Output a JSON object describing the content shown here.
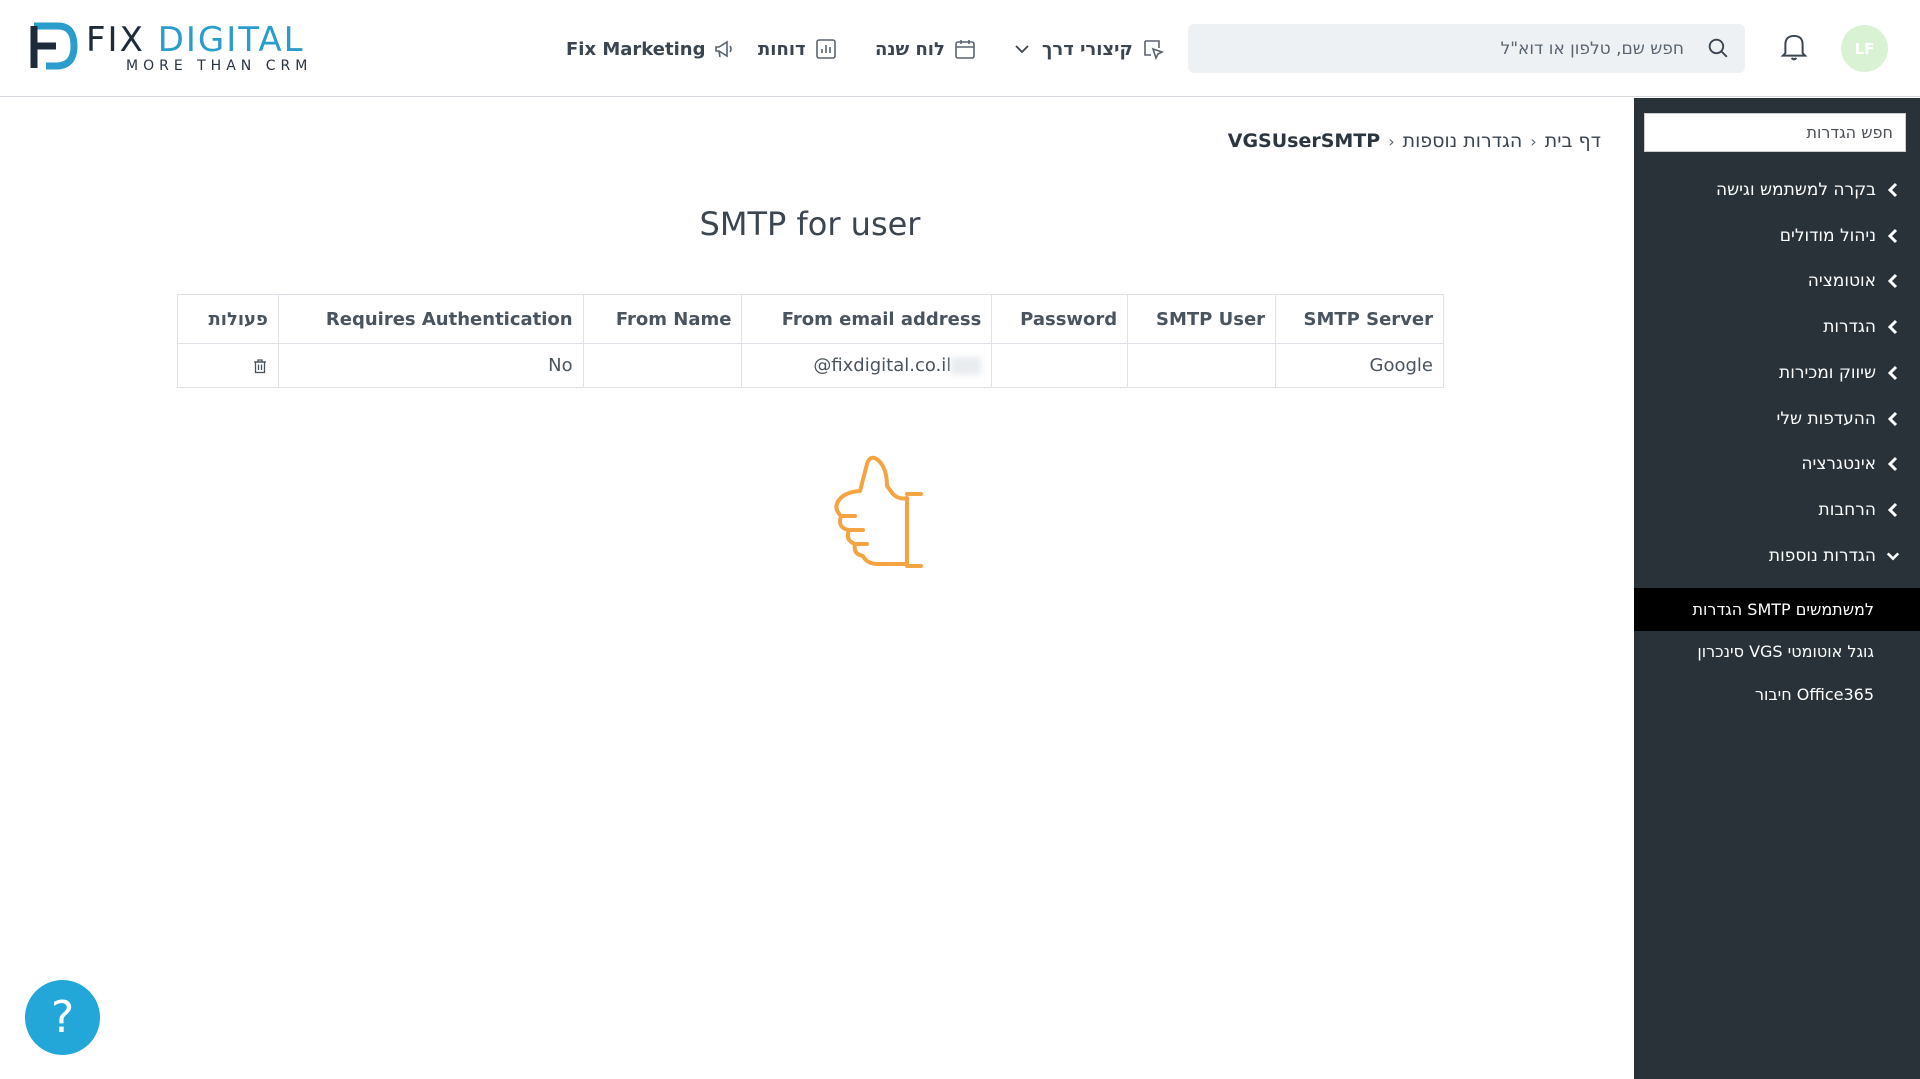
{
  "app": {
    "logo_word_fix": "FIX",
    "logo_word_digital": "DIGITAL",
    "logo_tagline": "MORE THAN CRM",
    "brand_color": "#2a9dcc"
  },
  "header": {
    "nav": {
      "fix_marketing": "Fix Marketing",
      "reports": "דוחות",
      "year_board": "לוח שנה",
      "shortcuts": "קיצורי דרך"
    },
    "search_placeholder": "חפש שם, טלפון או דוא\"ל",
    "avatar_initials": "LF"
  },
  "sidebar": {
    "search_placeholder": "חפש הגדרות",
    "items": [
      {
        "label": "בקרה למשתמש וגישה"
      },
      {
        "label": "ניהול מודולים"
      },
      {
        "label": "אוטומציה"
      },
      {
        "label": "הגדרות"
      },
      {
        "label": "שיווק ומכירות"
      },
      {
        "label": "ההעדפות שלי"
      },
      {
        "label": "אינטגרציה"
      },
      {
        "label": "הרחבות"
      },
      {
        "label": "הגדרות נוספות"
      }
    ],
    "subitems": [
      {
        "label": "הגדרות SMTP למשתמשים"
      },
      {
        "label": "סינכרון VGS גוגל אוטומטי"
      },
      {
        "label": "חיבור Office365"
      }
    ]
  },
  "breadcrumb": {
    "home": "דף בית",
    "section": "הגדרות נוספות",
    "current": "VGSUserSMTP"
  },
  "page": {
    "title": "SMTP for user"
  },
  "table": {
    "headers": [
      "SMTP Server",
      "SMTP User",
      "Password",
      "From email address",
      "From Name",
      "Requires Authentication",
      "פעולות"
    ],
    "rows": [
      {
        "smtp_server": "Google",
        "smtp_user": "",
        "password": "",
        "from_email": "@fixdigital.co.il",
        "from_name": "",
        "requires_auth": "No"
      }
    ]
  },
  "help": {
    "label": "?"
  }
}
